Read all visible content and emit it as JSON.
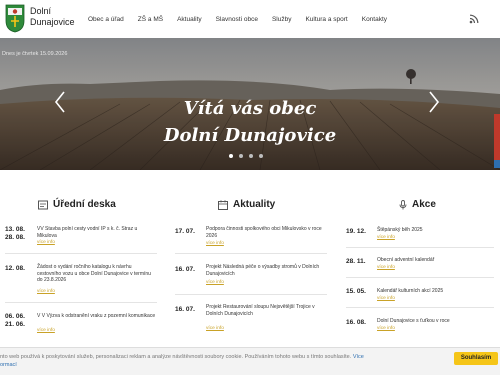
{
  "header": {
    "site_name_line1": "Dolní",
    "site_name_line2": "Dunajovice",
    "nav": [
      "Obec a úřad",
      "ZŠ a MŠ",
      "Aktuality",
      "Slavnosti obce",
      "Služby",
      "Kultura a sport",
      "Kontakty"
    ],
    "rss_icon": "rss-icon"
  },
  "hero": {
    "date": "Dnes je čtvrtek 15.09.2026",
    "title_line1": "Vítá vás obec",
    "title_line2": "Dolní Dunajovice",
    "active_slide": 1,
    "slide_count": 4
  },
  "columns": {
    "uredni_deska": {
      "title": "Úřední deska",
      "icon": "notice-board-icon",
      "items": [
        {
          "date1": "13. 08.",
          "date2": "28. 08.",
          "text": "VV Stavba polní cesty vodní IP s k. č. Straz u Mikulova",
          "link": "více info"
        },
        {
          "date1": "12. 08.",
          "date2": "",
          "text": "Žádost o vydání ročního katalogu k návrhu cestovního vozu u obce Dolní Dunajovice v termínu do 23.8.2026",
          "link": "více info"
        },
        {
          "date1": "06. 06.",
          "date2": "21. 06.",
          "text": "V V Výzva k odstranění vraku z pozemní komunikace",
          "link": "více info"
        }
      ]
    },
    "aktuality": {
      "title": "Aktuality",
      "icon": "calendar-icon",
      "items": [
        {
          "date": "17. 07.",
          "text": "Podpora činnosti spolkového obci Mikulovsko v roce 2026",
          "link": "více info"
        },
        {
          "date": "16. 07.",
          "text": "Projekt Následná péče o výsadby stromů v Dolních Dunajovicích",
          "link": "více info"
        },
        {
          "date": "16. 07.",
          "text": "Projekt Restaurování sloupu Nejsvětější Trojice v Dolních Dunajovicích",
          "link": "více info"
        }
      ]
    },
    "akce": {
      "title": "Akce",
      "icon": "microphone-icon",
      "items": [
        {
          "date": "19. 12.",
          "text": "Štěpánský běh 2025",
          "link": "více info"
        },
        {
          "date": "28. 11.",
          "text": "Obecní adventní kalendář",
          "link": "více info"
        },
        {
          "date": "15. 05.",
          "text": "Kalendář kulturních akcí 2025",
          "link": "více info"
        },
        {
          "date": "16. 08.",
          "text": "Dolní Dunajovice s ťuťkou v roce",
          "link": "více info"
        }
      ]
    }
  },
  "cookie": {
    "text": "nto web používá k poskytování služeb, personalizaci reklam a analýze návštěvnosti soubory cookie. Používáním tohoto webu s tímto souhlasíte.",
    "link_text": "Více",
    "link_text2": "ormací",
    "button": "Souhlasím"
  },
  "colors": {
    "accent": "#c9a227",
    "cookie_button": "#f5c518",
    "tab_red": "#c0392b",
    "tab_blue": "#2e6fb0"
  }
}
